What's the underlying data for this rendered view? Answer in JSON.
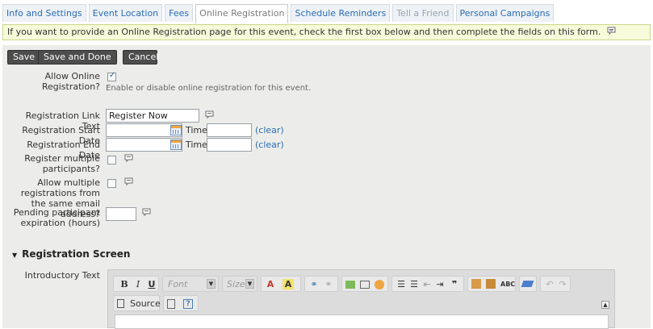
{
  "tabs": [
    {
      "label": "Info and Settings",
      "state": "normal"
    },
    {
      "label": "Event Location",
      "state": "normal"
    },
    {
      "label": "Fees",
      "state": "normal"
    },
    {
      "label": "Online Registration",
      "state": "active"
    },
    {
      "label": "Schedule Reminders",
      "state": "normal"
    },
    {
      "label": "Tell a Friend",
      "state": "disabled"
    },
    {
      "label": "Personal Campaigns",
      "state": "normal"
    }
  ],
  "info_bar": {
    "text": "If you want to provide an Online Registration page for this event, check the first box below and then complete the fields on this form."
  },
  "toolbar": {
    "save_label": "Save",
    "save_done_label": "Save and Done",
    "cancel_label": "Cancel"
  },
  "form": {
    "allow_online": {
      "label": "Allow Online Registration?",
      "checked": true,
      "hint": "Enable or disable online registration for this event."
    },
    "link_text": {
      "label": "Registration Link Text",
      "value": "Register Now"
    },
    "start_date": {
      "label": "Registration Start Date",
      "time_label": "Time",
      "clear_label": "(clear)"
    },
    "end_date": {
      "label": "Registration End Date",
      "time_label": "Time",
      "clear_label": "(clear)"
    },
    "multiple_participants": {
      "label": "Register multiple participants?",
      "checked": false
    },
    "multiple_same_email": {
      "label": "Allow multiple registrations from the same email address?",
      "checked": false
    },
    "pending_expiration": {
      "label": "Pending participant expiration (hours)",
      "value": ""
    }
  },
  "registration_screen": {
    "title": "Registration Screen",
    "intro_label": "Introductory Text",
    "editor": {
      "font_placeholder": "Font",
      "size_placeholder": "Size",
      "source_label": "Source"
    }
  },
  "colors": {
    "link": "#2a6db8",
    "info_bg": "#f7fbd9",
    "panel_bg": "#ecedea"
  },
  "icons": [
    "help-bubble-icon",
    "calendar-icon",
    "bold-icon",
    "italic-icon",
    "underline-icon"
  ]
}
